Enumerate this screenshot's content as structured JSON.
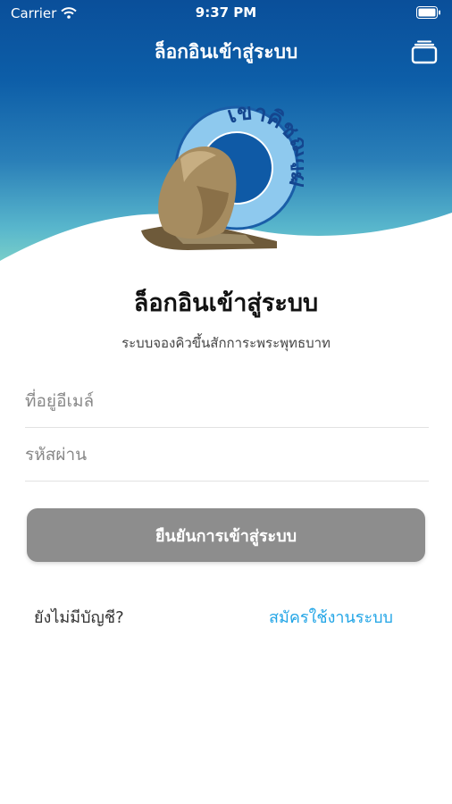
{
  "status_bar": {
    "carrier": "Carrier",
    "time": "9:37 PM"
  },
  "nav": {
    "title": "ล็อกอินเข้าสู่ระบบ"
  },
  "logo": {
    "text": "เขาคิชฌกูฏ"
  },
  "login": {
    "title": "ล็อกอินเข้าสู่ระบบ",
    "subtitle": "ระบบจองคิวขึ้นสักการะพระพุทธบาท",
    "email_placeholder": "ที่อยู่อีเมล์",
    "password_placeholder": "รหัสผ่าน",
    "submit_label": "ยืนยันการเข้าสู่ระบบ",
    "no_account_text": "ยังไม่มีบัญชี?",
    "register_label": "สมัครใช้งานระบบ"
  },
  "colors": {
    "header_top": "#0a4f9a",
    "header_bottom": "#7fd3c9",
    "button": "#8d8d8d",
    "link": "#22a5e6"
  }
}
